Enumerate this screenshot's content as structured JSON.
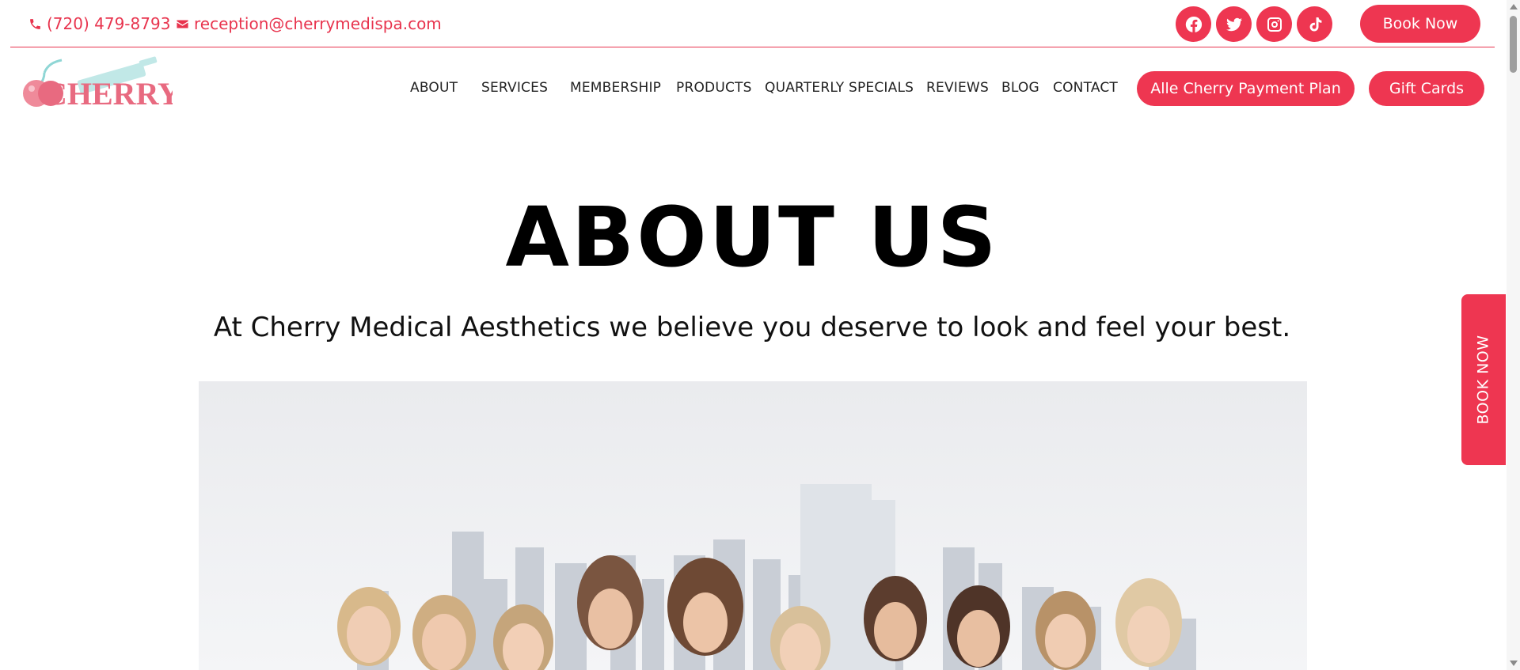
{
  "topbar": {
    "phone": "(720) 479-8793",
    "email": "reception@cherrymedispa.com",
    "social": [
      "facebook-icon",
      "twitter-icon",
      "instagram-icon",
      "tiktok-icon"
    ],
    "book_now": "Book Now"
  },
  "brand": {
    "logo_text": "CHERRY"
  },
  "nav": {
    "items": [
      "ABOUT",
      "SERVICES",
      "MEMBERSHIP",
      "PRODUCTS",
      "QUARTERLY SPECIALS",
      "REVIEWS",
      "BLOG",
      "CONTACT"
    ],
    "payment_plan": "Alle Cherry Payment Plan",
    "gift_cards": "Gift Cards"
  },
  "hero": {
    "title": "ABOUT US",
    "subtitle": "At Cherry Medical Aesthetics we believe you deserve to look and feel your best."
  },
  "side_tab": {
    "label": "BOOK NOW"
  },
  "colors": {
    "accent": "#ee3651",
    "text": "#222222",
    "logo_teal": "#7fd0cf"
  }
}
